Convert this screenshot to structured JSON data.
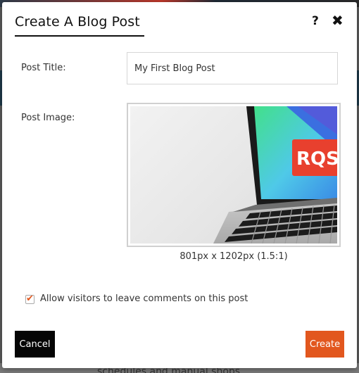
{
  "dialog": {
    "title": "Create A Blog Post",
    "help_icon": "?",
    "close_icon": "✖"
  },
  "form": {
    "post_title_label": "Post Title:",
    "post_title_value": "My First Blog Post",
    "post_image_label": "Post Image:",
    "image_dimensions": "801px x 1202px (1.5:1)",
    "image_badge_text": "RQS",
    "allow_comments_label": "Allow visitors to leave comments on this post",
    "allow_comments_checked": true
  },
  "actions": {
    "cancel_label": "Cancel",
    "create_label": "Create"
  },
  "background": {
    "bottom_text": "schedules and manual shops"
  },
  "colors": {
    "accent": "#e2571e",
    "cancel_bg": "#050505"
  }
}
